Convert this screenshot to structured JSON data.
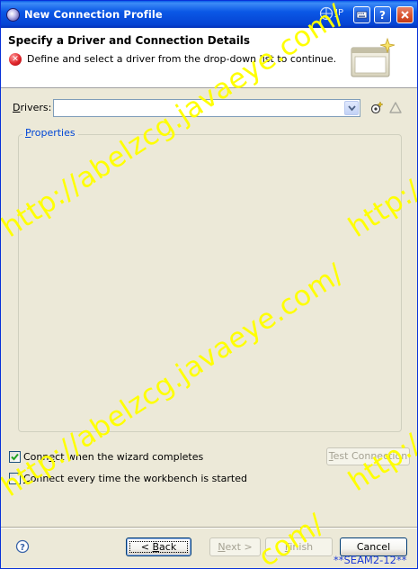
{
  "window": {
    "title": "New Connection Profile",
    "ime_label": "JP"
  },
  "banner": {
    "title": "Specify a Driver and Connection Details",
    "message": "Define and select a driver from the drop-down list to continue."
  },
  "drivers": {
    "label_mnemonic": "D",
    "label_rest": "rivers:",
    "selected_value": ""
  },
  "properties": {
    "legend_mnemonic": "P",
    "legend_rest": "roperties"
  },
  "options": {
    "connect_on_finish": {
      "checked": true,
      "label_pre": "Conn",
      "label_mnemonic": "e",
      "label_post": "ct when the wizard completes"
    },
    "connect_on_startup": {
      "checked": false,
      "label_pre": "",
      "label_mnemonic": "C",
      "label_post": "onnect every time the workbench is started"
    },
    "test_connection": {
      "label_mnemonic": "T",
      "label_rest": "est Connection",
      "enabled": false
    }
  },
  "buttons": {
    "back": {
      "prefix": "< ",
      "mnemonic": "B",
      "rest": "ack",
      "enabled": true
    },
    "next": {
      "mnemonic": "N",
      "rest": "ext >",
      "enabled": false
    },
    "finish": {
      "mnemonic": "F",
      "rest": "inish",
      "enabled": false
    },
    "cancel": {
      "label": "Cancel",
      "enabled": true
    }
  },
  "watermark": {
    "text": "http://abelzcg.javaeye.com/",
    "text_cut_right": "http://a",
    "text_cut_bottom": "com/",
    "color": "#ffff00",
    "signature": "**SEAM2-12**"
  },
  "colors": {
    "titlebar": "#0b58e6",
    "dialog_bg": "#ece9d8",
    "link_blue": "#0046d5",
    "error_red": "#e0252b",
    "signature_blue": "#1f3cd6"
  },
  "icons": {
    "app": "eclipse-icon",
    "error": "error-icon",
    "new_driver": "new-driver-icon",
    "edit_driver": "edit-driver-icon",
    "help": "help-icon"
  }
}
